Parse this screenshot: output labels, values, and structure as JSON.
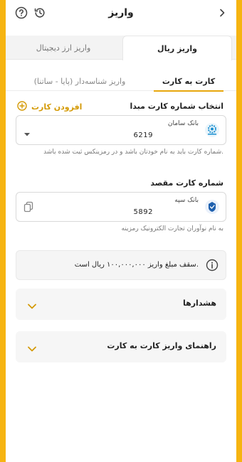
{
  "header": {
    "title": "واریز",
    "help_icon": "help-circle-icon",
    "history_icon": "history-icon",
    "back_icon": "chevron-right-icon"
  },
  "top_tabs": [
    {
      "label": "واریز ریال",
      "active": true
    },
    {
      "label": "واریز ارز دیجیتال",
      "active": false
    }
  ],
  "sub_tabs": [
    {
      "label": "کارت به کارت",
      "active": true
    },
    {
      "label": "واریز شناسه‌دار (پایا - ساتنا)",
      "active": false
    }
  ],
  "source": {
    "label": "انتخاب شماره کارت مبدا",
    "add_card_label": "افزودن کارت",
    "bank_name": "بانک سامان",
    "card_number": "6219",
    "hint": "شماره کارت باید به نام خودتان باشد و در رمزینکس ثبت شده باشد."
  },
  "destination": {
    "label": "شماره کارت مقصد",
    "bank_name": "بانک سپه",
    "card_number": "5892",
    "hint": "به نام نوآوران تجارت الکترونیک رمزینه"
  },
  "info": {
    "text": "سقف مبلغ واریز ۱۰۰,۰۰۰,۰۰۰ ریال است."
  },
  "accordions": [
    {
      "title": "هشدارها"
    },
    {
      "title": "راهنمای واریز کارت به کارت"
    }
  ],
  "colors": {
    "accent": "#e8a70c",
    "background": "#f6b411"
  }
}
